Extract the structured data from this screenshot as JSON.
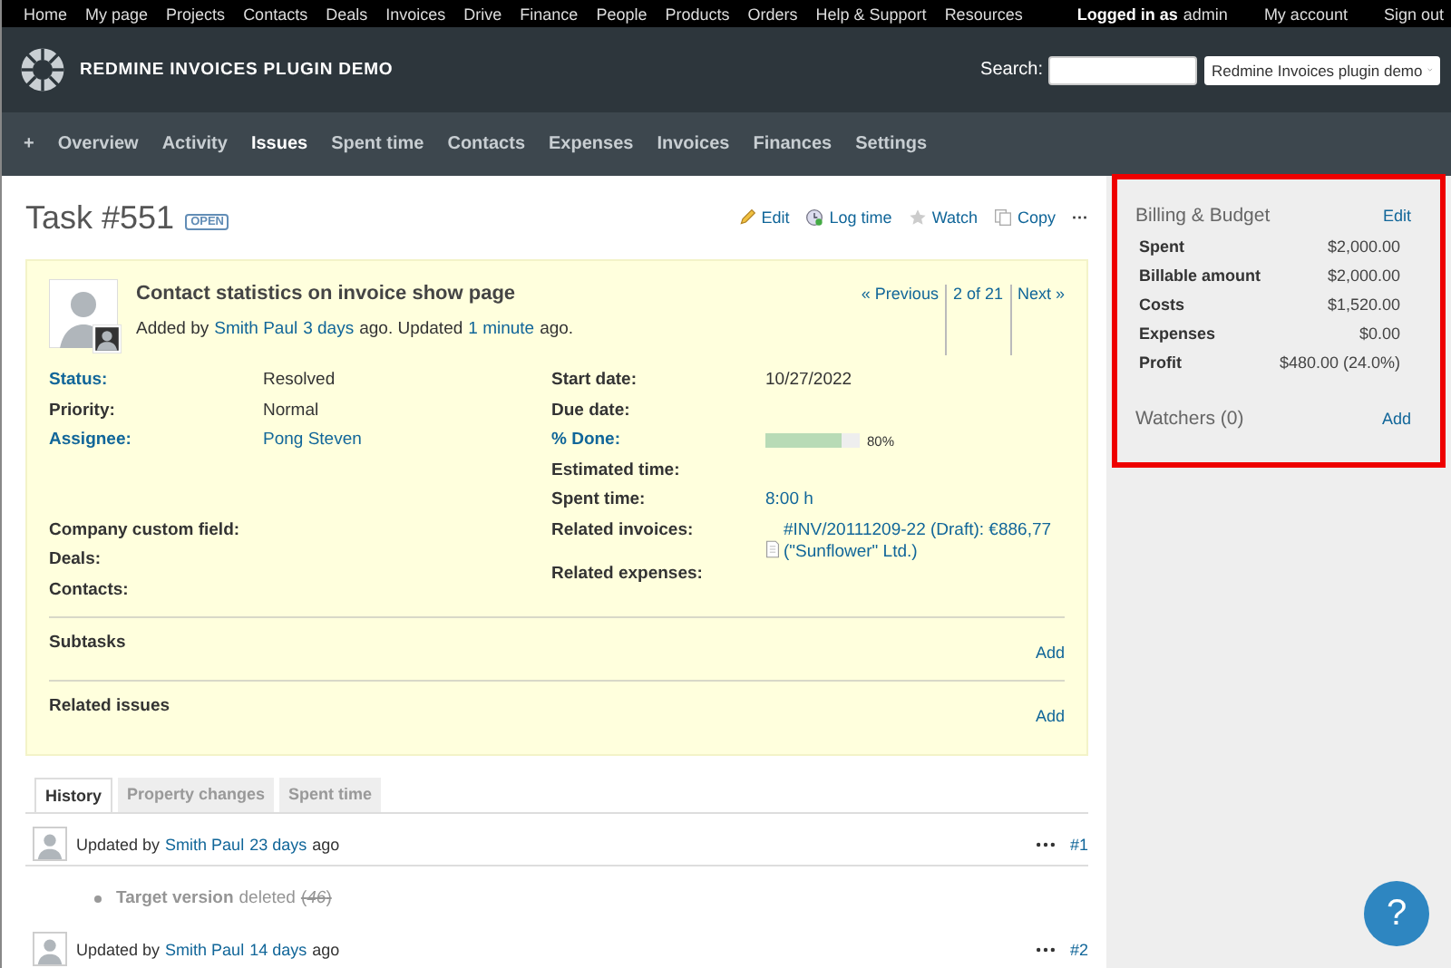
{
  "top_menu": {
    "items": [
      "Home",
      "My page",
      "Projects",
      "Contacts",
      "Deals",
      "Invoices",
      "Drive",
      "Finance",
      "People",
      "Products",
      "Orders",
      "Help & Support",
      "Resources"
    ],
    "logged_in_label": "Logged in as",
    "user": "admin",
    "links": [
      "My account",
      "Sign out"
    ]
  },
  "header": {
    "title": "REDMINE INVOICES PLUGIN DEMO",
    "search_label": "Search:",
    "project_select": "Redmine Invoices plugin demo"
  },
  "main_menu": [
    {
      "label": "+",
      "selected": false
    },
    {
      "label": "Overview",
      "selected": false
    },
    {
      "label": "Activity",
      "selected": false
    },
    {
      "label": "Issues",
      "selected": true
    },
    {
      "label": "Spent time",
      "selected": false
    },
    {
      "label": "Contacts",
      "selected": false
    },
    {
      "label": "Expenses",
      "selected": false
    },
    {
      "label": "Invoices",
      "selected": false
    },
    {
      "label": "Finances",
      "selected": false
    },
    {
      "label": "Settings",
      "selected": false
    }
  ],
  "issue": {
    "title": "Task #551",
    "status_badge": "OPEN",
    "actions": [
      {
        "kind": "edit",
        "label": "Edit"
      },
      {
        "kind": "log",
        "label": "Log time"
      },
      {
        "kind": "watch",
        "label": "Watch"
      },
      {
        "kind": "copy",
        "label": "Copy"
      },
      {
        "kind": "more",
        "label": "···"
      }
    ],
    "subject": "Contact statistics on invoice show page",
    "added": {
      "prefix": "Added by",
      "author": "Smith Paul",
      "age": "3 days",
      "middle": "ago. Updated",
      "updated": "1 minute",
      "suffix": "ago."
    },
    "nav": [
      "« Previous",
      "2 of 21",
      "Next »"
    ],
    "left_attributes": [
      {
        "label": "Status:",
        "label_link": true,
        "kind": "text",
        "value": "Resolved"
      },
      {
        "label": "Priority:",
        "label_link": false,
        "kind": "text",
        "value": "Normal"
      },
      {
        "label": "Assignee:",
        "label_link": true,
        "kind": "link",
        "value": "Pong Steven"
      },
      {
        "kind": "blank"
      },
      {
        "kind": "blank"
      },
      {
        "label": "Company custom field:",
        "label_link": false,
        "kind": "text"
      },
      {
        "label": "Deals:",
        "label_link": false,
        "kind": "text"
      },
      {
        "label": "Contacts:",
        "label_link": false,
        "kind": "text"
      }
    ],
    "right_attributes": [
      {
        "label": "Start date:",
        "label_link": false,
        "kind": "text",
        "value": "10/27/2022"
      },
      {
        "label": "Due date:",
        "label_link": false,
        "kind": "text"
      },
      {
        "label": "% Done:",
        "label_link": true,
        "kind": "progress",
        "level": 0.8,
        "value": "80%"
      },
      {
        "label": "Estimated time:",
        "label_link": false,
        "kind": "text"
      },
      {
        "label": "Spent time:",
        "label_link": false,
        "kind": "link",
        "value": "8:00 h"
      },
      {
        "label": "Related invoices:",
        "label_link": false,
        "kind": "invoice",
        "value": "#INV/20111209-22 (Draft): €886,77 (\"Sunflower\" Ltd.)"
      },
      {
        "label": "Related expenses:",
        "label_link": false,
        "kind": "text"
      }
    ],
    "sections": [
      {
        "title": "Subtasks",
        "action": "Add"
      },
      {
        "title": "Related issues",
        "action": "Add"
      }
    ]
  },
  "tabs": [
    {
      "label": "History",
      "selected": true
    },
    {
      "label": "Property changes",
      "selected": false
    },
    {
      "label": "Spent time",
      "selected": false
    }
  ],
  "journals": [
    {
      "prefix": "Updated by",
      "author": "Smith Paul",
      "age": "23 days",
      "suffix": "ago",
      "number": "#1",
      "details": [
        {
          "field": "Target version",
          "action": "deleted",
          "old_value": "(*46*)"
        }
      ]
    },
    {
      "prefix": "Updated by",
      "author": "Smith Paul",
      "age": "14 days",
      "suffix": "ago",
      "number": "#2"
    }
  ],
  "sidebar": {
    "billing": {
      "title": "Billing & Budget",
      "action": "Edit",
      "rows": [
        {
          "label": "Spent",
          "value": "$2,000.00"
        },
        {
          "label": "Billable amount",
          "value": "$2,000.00"
        },
        {
          "label": "Costs",
          "value": "$1,520.00"
        },
        {
          "label": "Expenses",
          "value": "$0.00"
        },
        {
          "label": "Profit",
          "value": "$480.00 (24.0%)"
        }
      ]
    },
    "watchers": {
      "title": "Watchers (0)",
      "action": "Add"
    },
    "highlighted": true
  },
  "help_button": "?"
}
